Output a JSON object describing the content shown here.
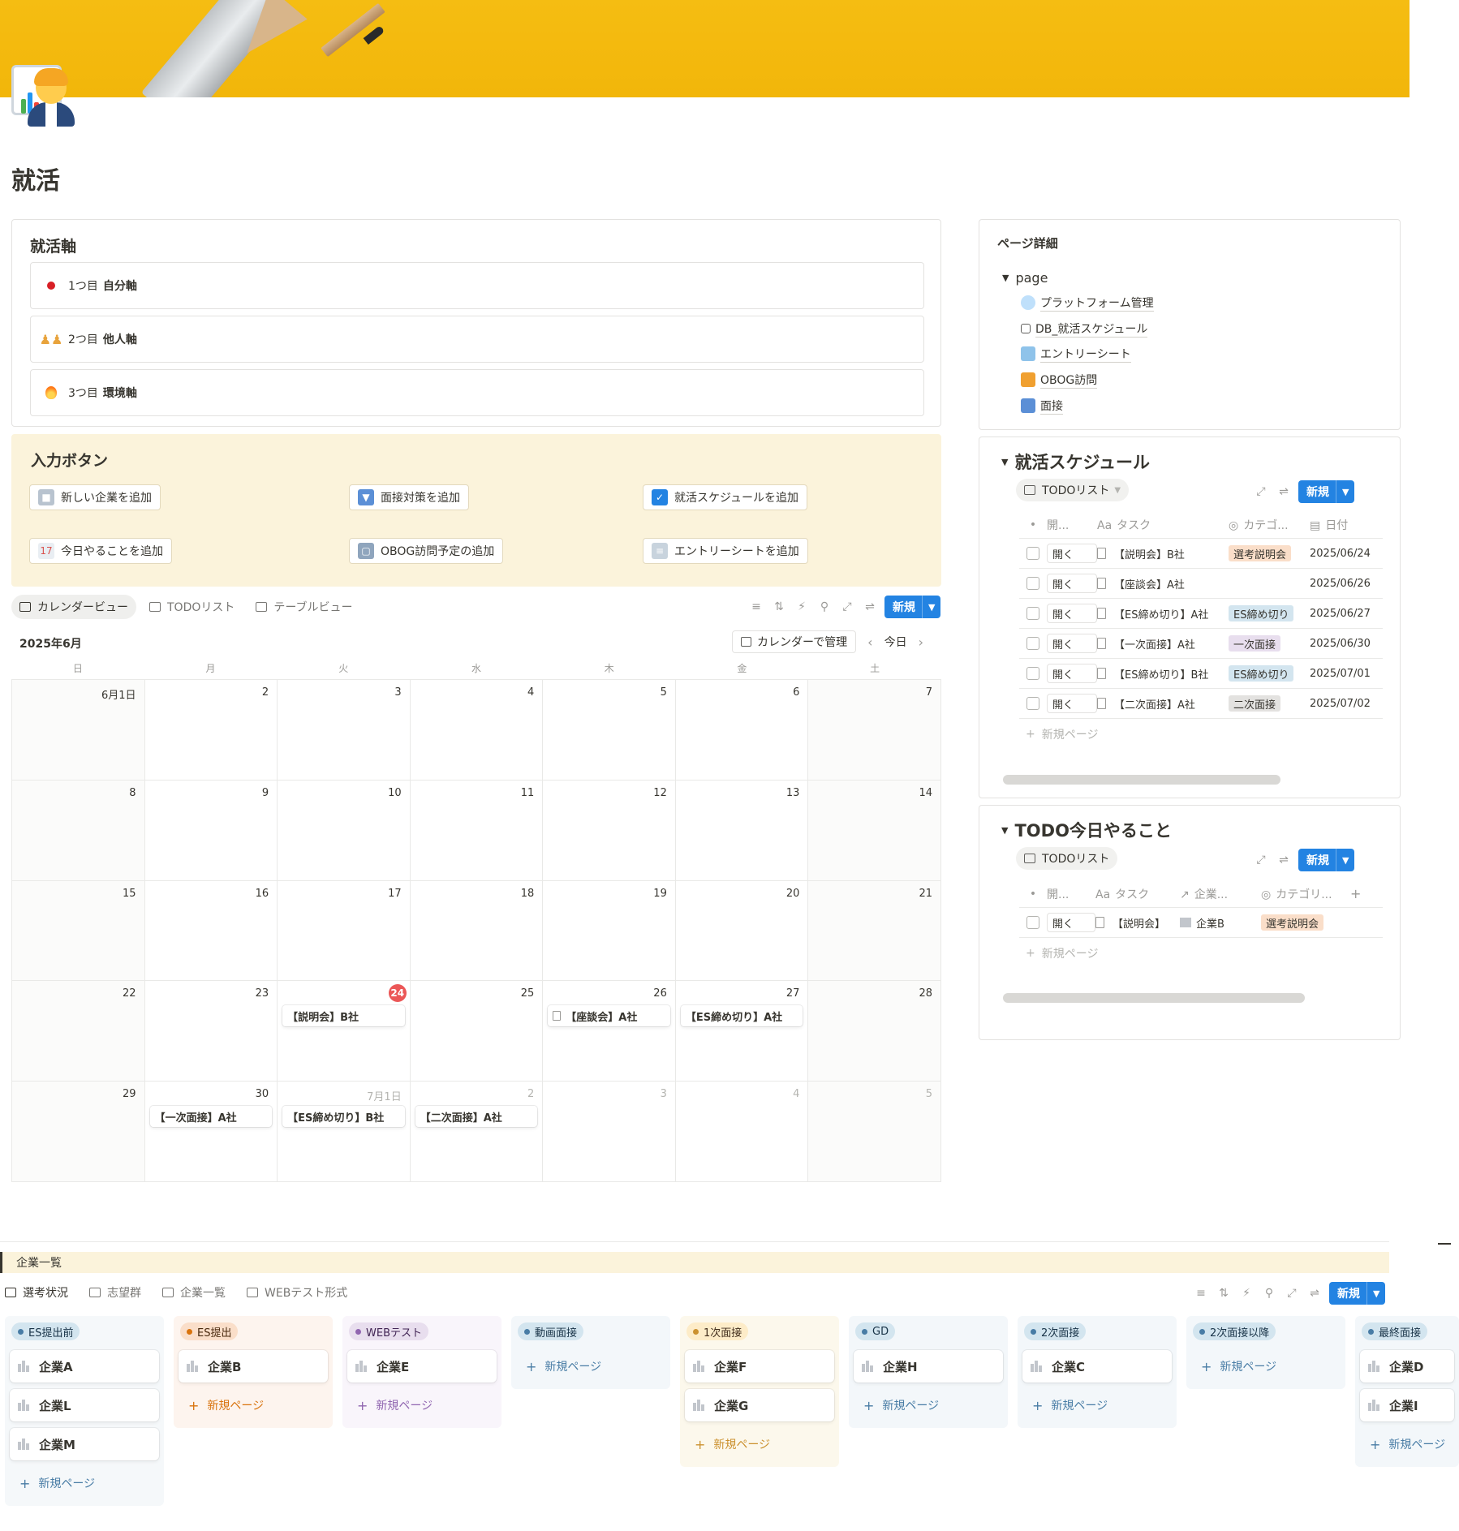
{
  "page": {
    "title": "就活"
  },
  "axis": {
    "title": "就活軸",
    "items": [
      {
        "prefix": "1つ目",
        "label": "自分軸"
      },
      {
        "prefix": "2つ目",
        "label": "他人軸"
      },
      {
        "prefix": "3つ目",
        "label": "環境軸"
      }
    ]
  },
  "input": {
    "title": "入力ボタン",
    "buttons": [
      "新しい企業を追加",
      "面接対策を追加",
      "就活スケジュールを追加",
      "今日やることを追加",
      "OBOG訪問予定の追加",
      "エントリーシートを追加"
    ]
  },
  "views": {
    "tabs": [
      "カレンダービュー",
      "TODOリスト",
      "テーブルビュー"
    ],
    "new_label": "新規"
  },
  "calendar": {
    "month": "2025年6月",
    "manage": "カレンダーで管理",
    "today": "今日",
    "weekdays": [
      "日",
      "月",
      "火",
      "水",
      "木",
      "金",
      "土"
    ],
    "days": [
      "6月1日",
      "2",
      "3",
      "4",
      "5",
      "6",
      "7",
      "8",
      "9",
      "10",
      "11",
      "12",
      "13",
      "14",
      "15",
      "16",
      "17",
      "18",
      "19",
      "20",
      "21",
      "22",
      "23",
      "24",
      "25",
      "26",
      "27",
      "28",
      "29",
      "30",
      "7月1日",
      "2",
      "3",
      "4",
      "5"
    ],
    "events": [
      {
        "day_index": 23,
        "label": "【説明会】B社"
      },
      {
        "day_index": 25,
        "label": "【座談会】A社"
      },
      {
        "day_index": 26,
        "label": "【ES締め切り】A社"
      },
      {
        "day_index": 29,
        "label": "【一次面接】A社"
      },
      {
        "day_index": 30,
        "label": "【ES締め切り】B社"
      },
      {
        "day_index": 31,
        "label": "【二次面接】A社"
      }
    ]
  },
  "details": {
    "title": "ページ詳細",
    "tree_label": "page",
    "links": [
      "プラットフォーム管理",
      "DB_就活スケジュール",
      "エントリーシート",
      "OBOG訪問",
      "面接"
    ]
  },
  "schedule": {
    "title": "就活スケジュール",
    "view": "TODOリスト",
    "new_label": "新規",
    "headers": [
      "開...",
      "タスク",
      "カテゴ...",
      "日付"
    ],
    "open_label": "開く",
    "rows": [
      {
        "task": "【説明会】B社",
        "category": "選考説明会",
        "date": "2025/06/24",
        "tag_color": "#fadec9"
      },
      {
        "task": "【座談会】A社",
        "category": "",
        "date": "2025/06/26",
        "tag_color": ""
      },
      {
        "task": "【ES締め切り】A社",
        "category": "ES締め切り",
        "date": "2025/06/27",
        "tag_color": "#d3e5ef"
      },
      {
        "task": "【一次面接】A社",
        "category": "一次面接",
        "date": "2025/06/30",
        "tag_color": "#e8deee"
      },
      {
        "task": "【ES締め切り】B社",
        "category": "ES締め切り",
        "date": "2025/07/01",
        "tag_color": "#d3e5ef"
      },
      {
        "task": "【二次面接】A社",
        "category": "二次面接",
        "date": "2025/07/02",
        "tag_color": "#e3e2e0"
      }
    ],
    "new_page": "新規ページ"
  },
  "todo": {
    "title": "TODO今日やること",
    "view": "TODOリスト",
    "new_label": "新規",
    "headers": [
      "開...",
      "タスク",
      "企業...",
      "カテゴリ..."
    ],
    "open_label": "開く",
    "rows": [
      {
        "task": "【説明会】",
        "company": "企業B",
        "category": "選考説明会"
      }
    ],
    "new_page": "新規ページ"
  },
  "board": {
    "header": "企業一覧",
    "tabs": [
      "選考状況",
      "志望群",
      "企業一覧",
      "WEBテスト形式"
    ],
    "new_label": "新規",
    "new_page": "新規ページ",
    "columns": [
      {
        "name": "ES提出前",
        "bg": "#f5f8fa",
        "pill": "#d3e5ef",
        "dot": "#487ca5",
        "text": "#183347",
        "add": "#487ca5",
        "cards": [
          "企業A",
          "企業L",
          "企業M"
        ]
      },
      {
        "name": "ES提出",
        "bg": "#fdf4ee",
        "pill": "#fadec9",
        "dot": "#d9730d",
        "text": "#49290e",
        "add": "#d9730d",
        "cards": [
          "企業B"
        ]
      },
      {
        "name": "WEBテスト",
        "bg": "#f9f5fb",
        "pill": "#e8deee",
        "dot": "#9065b0",
        "text": "#412454",
        "add": "#9065b0",
        "cards": [
          "企業E"
        ]
      },
      {
        "name": "動画面接",
        "bg": "#f3f7fa",
        "pill": "#d3e5ef",
        "dot": "#487ca5",
        "text": "#183347",
        "add": "#487ca5",
        "cards": []
      },
      {
        "name": "1次面接",
        "bg": "#fcf8ec",
        "pill": "#fdecc8",
        "dot": "#cb912f",
        "text": "#402c1b",
        "add": "#cb912f",
        "cards": [
          "企業F",
          "企業G"
        ]
      },
      {
        "name": "GD",
        "bg": "#f3f7fa",
        "pill": "#d3e5ef",
        "dot": "#487ca5",
        "text": "#183347",
        "add": "#487ca5",
        "cards": [
          "企業H"
        ]
      },
      {
        "name": "2次面接",
        "bg": "#f3f7fa",
        "pill": "#d3e5ef",
        "dot": "#487ca5",
        "text": "#183347",
        "add": "#487ca5",
        "cards": [
          "企業C"
        ]
      },
      {
        "name": "2次面接以降",
        "bg": "#f3f7fa",
        "pill": "#d3e5ef",
        "dot": "#487ca5",
        "text": "#183347",
        "add": "#487ca5",
        "cards": []
      },
      {
        "name": "最終面接",
        "bg": "#f3f7fa",
        "pill": "#d3e5ef",
        "dot": "#487ca5",
        "text": "#183347",
        "add": "#487ca5",
        "cards": [
          "企業D",
          "企業I"
        ]
      }
    ]
  },
  "colors": {
    "accent": "#2383e2",
    "input_bg": "#fbf3db",
    "today_badge": "#eb5757"
  }
}
